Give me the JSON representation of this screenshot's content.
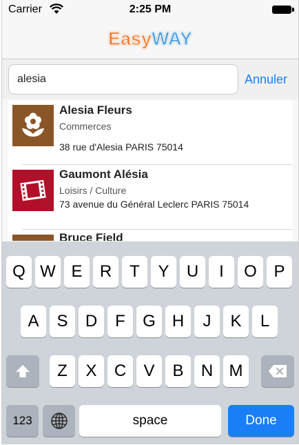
{
  "status_bar": {
    "carrier": "Carrier",
    "time": "2:25 PM"
  },
  "nav": {
    "logo_easy": "Easy",
    "logo_way": "WAY"
  },
  "search": {
    "value": "alesia",
    "cancel_label": "Annuler"
  },
  "results": [
    {
      "title": "Alesia Fleurs",
      "category": "Commerces",
      "address": "38 rue d'Alesia PARIS 75014",
      "icon": "flower-icon",
      "color": "#8a5628"
    },
    {
      "title": "Gaumont Alésia",
      "category": "Loisirs / Culture",
      "address": "73 avenue du Général Leclerc PARIS 75014",
      "icon": "film-icon",
      "color": "#b2102a"
    },
    {
      "title": "Bruce Field",
      "icon": "store-icon",
      "color": "#8a5628"
    }
  ],
  "keyboard": {
    "row1": [
      "Q",
      "W",
      "E",
      "R",
      "T",
      "Y",
      "U",
      "I",
      "O",
      "P"
    ],
    "row2": [
      "A",
      "S",
      "D",
      "F",
      "G",
      "H",
      "J",
      "K",
      "L"
    ],
    "row3": [
      "Z",
      "X",
      "C",
      "V",
      "B",
      "N",
      "M"
    ],
    "numbers_label": "123",
    "space_label": "space",
    "done_label": "Done"
  }
}
